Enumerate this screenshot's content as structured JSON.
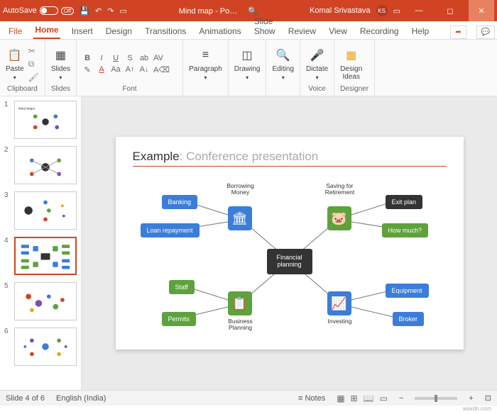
{
  "titlebar": {
    "autosave": "AutoSave",
    "autosave_state": "Off",
    "title": "Mind map - Po…",
    "user": "Komal Srivastava",
    "initials": "KS"
  },
  "tabs": {
    "file": "File",
    "home": "Home",
    "insert": "Insert",
    "design": "Design",
    "transitions": "Transitions",
    "animations": "Animations",
    "slideshow": "Slide Show",
    "review": "Review",
    "view": "View",
    "recording": "Recording",
    "help": "Help"
  },
  "ribbon": {
    "clipboard": {
      "paste": "Paste",
      "label": "Clipboard"
    },
    "slides": {
      "slides": "Slides",
      "label": "Slides"
    },
    "font": {
      "label": "Font"
    },
    "paragraph": {
      "paragraph": "Paragraph",
      "label": "…"
    },
    "drawing": {
      "drawing": "Drawing"
    },
    "editing": {
      "editing": "Editing"
    },
    "voice": {
      "dictate": "Dictate",
      "label": "Voice"
    },
    "designer": {
      "design_ideas": "Design\nIdeas",
      "label": "Designer"
    }
  },
  "thumbs": [
    "1",
    "2",
    "3",
    "4",
    "5",
    "6"
  ],
  "slide": {
    "example": "Example",
    "subtitle": ": Conference presentation",
    "center": "Financial planning",
    "borrowing": "Borrowing Money",
    "saving": "Saving for Retirement",
    "business": "Business Planning",
    "investing": "Investing",
    "nodes": {
      "banking": "Banking",
      "loan": "Loan repayment",
      "staff": "Staff",
      "permits": "Permits",
      "exit": "Exit plan",
      "howmuch": "How much?",
      "equipment": "Equipment",
      "broker": "Broker"
    }
  },
  "status": {
    "slide": "Slide 4 of 6",
    "lang": "English (India)",
    "notes": "Notes"
  },
  "footer": "wsxdn.com"
}
